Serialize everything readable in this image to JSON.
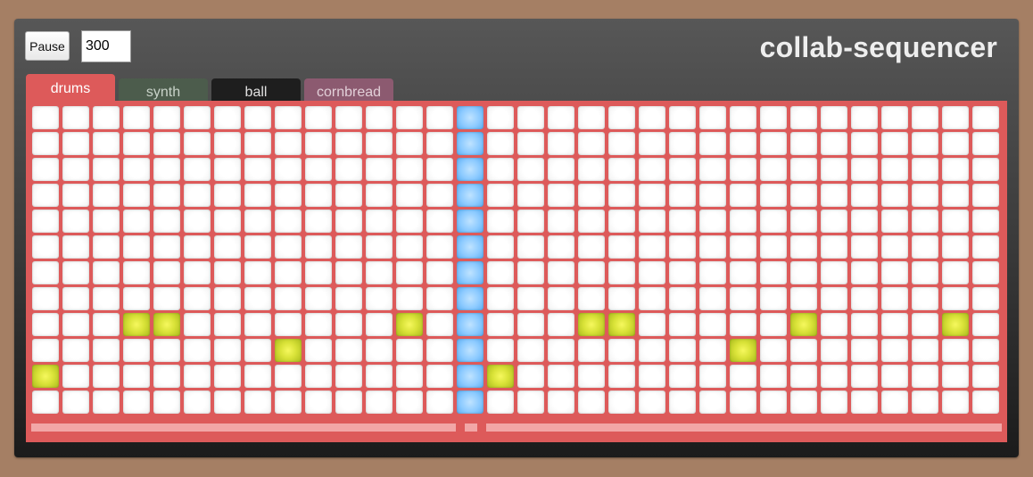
{
  "app": {
    "title": "collab-sequencer"
  },
  "controls": {
    "pause_label": "Pause",
    "tempo_value": "300"
  },
  "tabs": [
    {
      "label": "drums",
      "bg": "#dd5a5a",
      "color": "#ffffff",
      "active": true
    },
    {
      "label": "synth",
      "bg": "#4c5c4c",
      "color": "#c8d2c8",
      "active": false
    },
    {
      "label": "ball",
      "bg": "#1e1e1e",
      "color": "#e0e0e0",
      "active": false
    },
    {
      "label": "cornbread",
      "bg": "#8c5a70",
      "color": "#e2cfd8",
      "active": false
    }
  ],
  "sequencer": {
    "columns": 32,
    "rows": 12,
    "playhead_column": 14,
    "active_color": "#d9e238",
    "playhead_color": "#8ccaff",
    "panel_color": "#dd5a5a",
    "active_cells": [
      [
        8,
        3
      ],
      [
        8,
        4
      ],
      [
        8,
        12
      ],
      [
        8,
        18
      ],
      [
        8,
        19
      ],
      [
        8,
        25
      ],
      [
        8,
        30
      ],
      [
        9,
        8
      ],
      [
        9,
        23
      ],
      [
        10,
        0
      ],
      [
        10,
        15
      ]
    ]
  }
}
